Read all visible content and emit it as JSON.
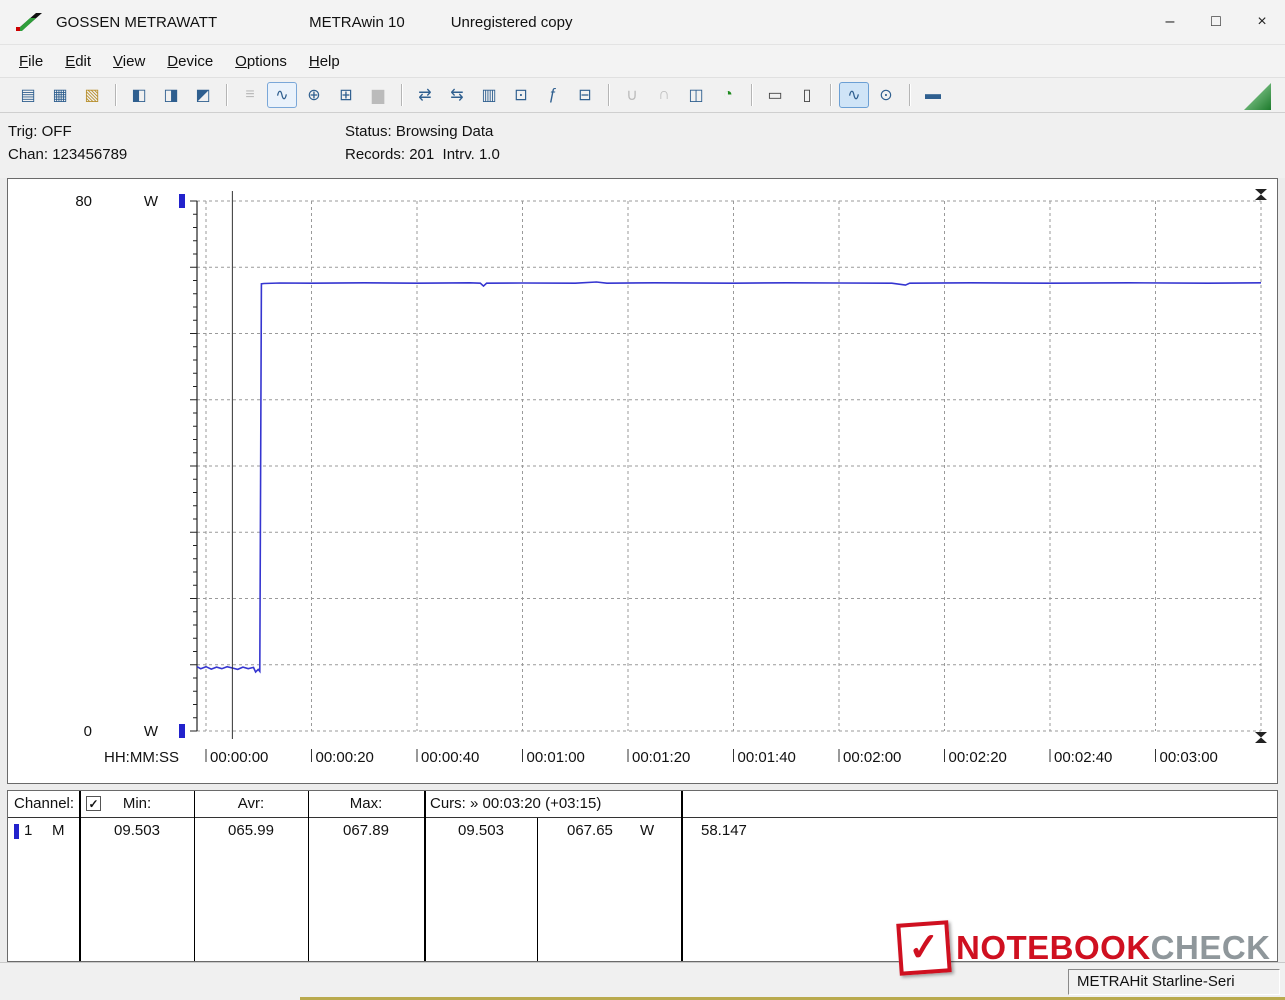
{
  "window": {
    "brand": "GOSSEN METRAWATT",
    "app": "METRAwin 10",
    "note": "Unregistered copy",
    "controls": {
      "minimize": "–",
      "maximize": "□",
      "close": "×"
    }
  },
  "menu": {
    "items": [
      "File",
      "Edit",
      "View",
      "Device",
      "Options",
      "Help"
    ]
  },
  "toolbar": {
    "groups": [
      [
        {
          "name": "open-file-icon",
          "glyph": "▤",
          "color": "#2f5f8f"
        },
        {
          "name": "save-file-icon",
          "glyph": "▦",
          "color": "#2f5f8f"
        },
        {
          "name": "open-folder-icon",
          "glyph": "▧",
          "color": "#b8902f"
        }
      ],
      [
        {
          "name": "export-data-icon",
          "glyph": "◧",
          "color": "#2f5f8f"
        },
        {
          "name": "copy-screen-icon",
          "glyph": "◨",
          "color": "#2f5f8f"
        },
        {
          "name": "copy-window-icon",
          "glyph": "◩",
          "color": "#2f5f8f"
        }
      ],
      [
        {
          "name": "numeric-display-icon",
          "glyph": "≡",
          "color": "#2f5f8f",
          "disabled": true
        },
        {
          "name": "yt-chart-icon",
          "glyph": "∿",
          "color": "#2f5f8f",
          "checked": true
        },
        {
          "name": "xy-chart-icon",
          "glyph": "⊕",
          "color": "#2f5f8f"
        },
        {
          "name": "table-view-icon",
          "glyph": "⊞",
          "color": "#2f5f8f"
        },
        {
          "name": "histogram-icon",
          "glyph": "▆",
          "color": "#2f5f8f",
          "disabled": true
        }
      ],
      [
        {
          "name": "device-send-icon",
          "glyph": "⇄",
          "color": "#2f5f8f"
        },
        {
          "name": "device-read-icon",
          "glyph": "⇆",
          "color": "#2f5f8f"
        },
        {
          "name": "device-settings-icon",
          "glyph": "▥",
          "color": "#2f5f8f"
        },
        {
          "name": "monitor-icon",
          "glyph": "⊡",
          "color": "#2f5f8f"
        },
        {
          "name": "formula-icon",
          "glyph": "ƒ",
          "color": "#2f5f8f"
        },
        {
          "name": "pc-display-icon",
          "glyph": "⊟",
          "color": "#2f5f8f"
        }
      ],
      [
        {
          "name": "wave-low-icon",
          "glyph": "∪",
          "color": "#2f5f8f",
          "disabled": true
        },
        {
          "name": "wave-high-icon",
          "glyph": "∩",
          "color": "#2f5f8f",
          "disabled": true
        },
        {
          "name": "compare-pages-icon",
          "glyph": "◫",
          "color": "#2f5f8f"
        },
        {
          "name": "timer-icon",
          "glyph": "◔",
          "color": "#1e8a1e"
        }
      ],
      [
        {
          "name": "print-icon",
          "glyph": "▭",
          "color": "#444444"
        },
        {
          "name": "print-preview-icon",
          "glyph": "▯",
          "color": "#444444"
        }
      ],
      [
        {
          "name": "zoom-time-icon",
          "glyph": "∿",
          "color": "#2f5f8f",
          "pressed": true
        },
        {
          "name": "zoom-signal-icon",
          "glyph": "⊙",
          "color": "#2f5f8f"
        }
      ],
      [
        {
          "name": "annotation-icon",
          "glyph": "▬",
          "color": "#2f5f8f"
        }
      ]
    ]
  },
  "status": {
    "trig": "Trig: OFF",
    "chan": "Chan: 123456789",
    "status": "Status: Browsing Data",
    "records": "Records: 201  Intrv. 1.0"
  },
  "chart_data": {
    "type": "line",
    "title": "",
    "y_axis": {
      "max_label": "80",
      "min_label": "0",
      "unit": "W",
      "ylim": [
        0,
        80
      ],
      "major_step": 10,
      "minor_step": 2
    },
    "x_axis": {
      "label": "HH:MM:SS",
      "range_seconds": [
        0,
        200
      ],
      "tick_step_seconds": 20,
      "tick_labels": [
        "00:00:00",
        "00:00:20",
        "00:00:40",
        "00:01:00",
        "00:01:20",
        "00:01:40",
        "00:02:00",
        "00:02:20",
        "00:02:40",
        "00:03:00"
      ]
    },
    "grid": {
      "style": "dashed",
      "color": "#9a9a9a"
    },
    "series": [
      {
        "name": "channel-1-power",
        "color": "#3535d0",
        "unit": "W",
        "points": [
          [
            -1.7,
            9.7
          ],
          [
            -1,
            9.4
          ],
          [
            0,
            9.7
          ],
          [
            1,
            9.35
          ],
          [
            2,
            9.65
          ],
          [
            3,
            9.4
          ],
          [
            4,
            9.7
          ],
          [
            5,
            9.503
          ],
          [
            6,
            9.3
          ],
          [
            7,
            9.65
          ],
          [
            8,
            9.4
          ],
          [
            9,
            9.6
          ],
          [
            9.4,
            8.9
          ],
          [
            9.9,
            9.3
          ],
          [
            10.2,
            9.0
          ],
          [
            10.5,
            67.5
          ],
          [
            11,
            67.55
          ],
          [
            14,
            67.62
          ],
          [
            20,
            67.6
          ],
          [
            30,
            67.65
          ],
          [
            40,
            67.6
          ],
          [
            50,
            67.65
          ],
          [
            52,
            67.6
          ],
          [
            52.6,
            67.15
          ],
          [
            53.2,
            67.6
          ],
          [
            60,
            67.62
          ],
          [
            70,
            67.6
          ],
          [
            74,
            67.78
          ],
          [
            76,
            67.6
          ],
          [
            85,
            67.65
          ],
          [
            100,
            67.6
          ],
          [
            110,
            67.65
          ],
          [
            120,
            67.62
          ],
          [
            130,
            67.6
          ],
          [
            132.6,
            67.3
          ],
          [
            133.4,
            67.6
          ],
          [
            145,
            67.65
          ],
          [
            160,
            67.6
          ],
          [
            175,
            67.65
          ],
          [
            190,
            67.6
          ],
          [
            200,
            67.65
          ]
        ]
      }
    ],
    "cursors": {
      "c1_seconds": 5,
      "c2_seconds": 200,
      "c1_value": 9.503,
      "c2_value": 67.65,
      "delta": 58.147
    },
    "stats": {
      "min": 9.503,
      "avg": 65.99,
      "max": 67.89,
      "records": 201,
      "interval_s": 1.0
    },
    "marker_color": "#2222cc"
  },
  "stats_panel": {
    "channel_label": "Channel:",
    "checkbox_glyph": "✓",
    "headers": {
      "min": "Min:",
      "avr": "Avr:",
      "max": "Max:",
      "curs": "Curs: » 00:03:20 (+03:15)"
    },
    "row": {
      "marker_color": "#2222cc",
      "channel": "1",
      "mode": "M",
      "min": "09.503",
      "avr": "065.99",
      "max": "067.89",
      "curs1": "09.503",
      "curs2": "067.65",
      "unit": "W",
      "delta": "58.147"
    }
  },
  "footer": {
    "device": "METRAHit Starline-Seri"
  },
  "watermark": {
    "word1": "NOTEBOOK",
    "word2": "CHECK",
    "check_glyph": "✓"
  }
}
